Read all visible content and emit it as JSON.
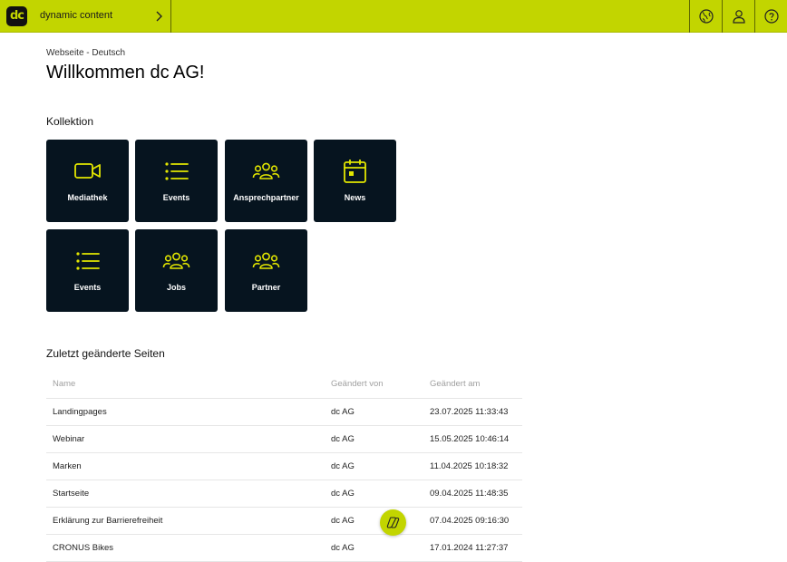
{
  "header": {
    "logo_text": "dc",
    "app_name": "dynamic content",
    "icons": [
      "globe-icon",
      "user-icon",
      "help-icon"
    ]
  },
  "breadcrumb": "Webseite - Deutsch",
  "page_title": "Willkommen dc AG!",
  "collection": {
    "heading": "Kollektion",
    "tiles": [
      {
        "label": "Mediathek",
        "icon": "video-camera-icon"
      },
      {
        "label": "Events",
        "icon": "list-icon"
      },
      {
        "label": "Ansprechpartner",
        "icon": "people-icon"
      },
      {
        "label": "News",
        "icon": "calendar-icon"
      },
      {
        "label": "Events",
        "icon": "list-icon"
      },
      {
        "label": "Jobs",
        "icon": "people-icon"
      },
      {
        "label": "Partner",
        "icon": "people-icon"
      }
    ]
  },
  "recent": {
    "heading": "Zuletzt geänderte Seiten",
    "columns": [
      "Name",
      "Geändert von",
      "Geändert am"
    ],
    "rows": [
      [
        "Landingpages",
        "dc AG",
        "23.07.2025 11:33:43"
      ],
      [
        "Webinar",
        "dc AG",
        "15.05.2025 10:46:14"
      ],
      [
        "Marken",
        "dc AG",
        "11.04.2025 10:18:32"
      ],
      [
        "Startseite",
        "dc AG",
        "09.04.2025 11:48:35"
      ],
      [
        "Erklärung zur Barrierefreiheit",
        "dc AG",
        "07.04.2025 09:16:30"
      ],
      [
        "CRONUS Bikes",
        "dc AG",
        "17.01.2024 11:27:37"
      ]
    ]
  },
  "colors": {
    "accent": "#c2d500",
    "tile_bg": "#06141f",
    "tile_icon": "#e2e600"
  }
}
